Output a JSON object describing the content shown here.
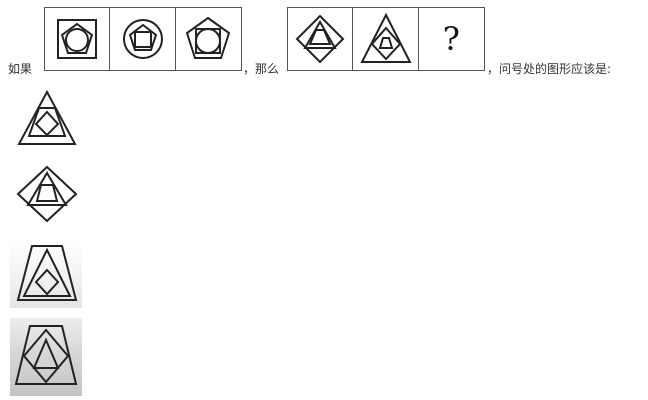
{
  "question": {
    "prefix": "如果",
    "middle": "，那么",
    "suffix": "，问号处的图形应该是:",
    "unknown_mark": "?"
  },
  "strip1": {
    "cells": [
      {
        "description_icon": "square-pentagon-circle-icon"
      },
      {
        "description_icon": "circle-pentagon-square-icon"
      },
      {
        "description_icon": "pentagon-square-circle-icon"
      }
    ]
  },
  "strip2": {
    "cells": [
      {
        "description_icon": "diamond-triangle-trapezoid-icon"
      },
      {
        "description_icon": "triangle-diamond-trapezoid-icon"
      },
      {
        "description_icon": "question-mark"
      }
    ]
  },
  "options": [
    {
      "icon": "triangle-trapezoid-diamond-icon"
    },
    {
      "icon": "diamond-triangle-trapezoid-icon"
    },
    {
      "icon": "trapezoid-triangle-diamond-icon"
    },
    {
      "icon": "trapezoid-diamond-triangle-icon"
    }
  ]
}
